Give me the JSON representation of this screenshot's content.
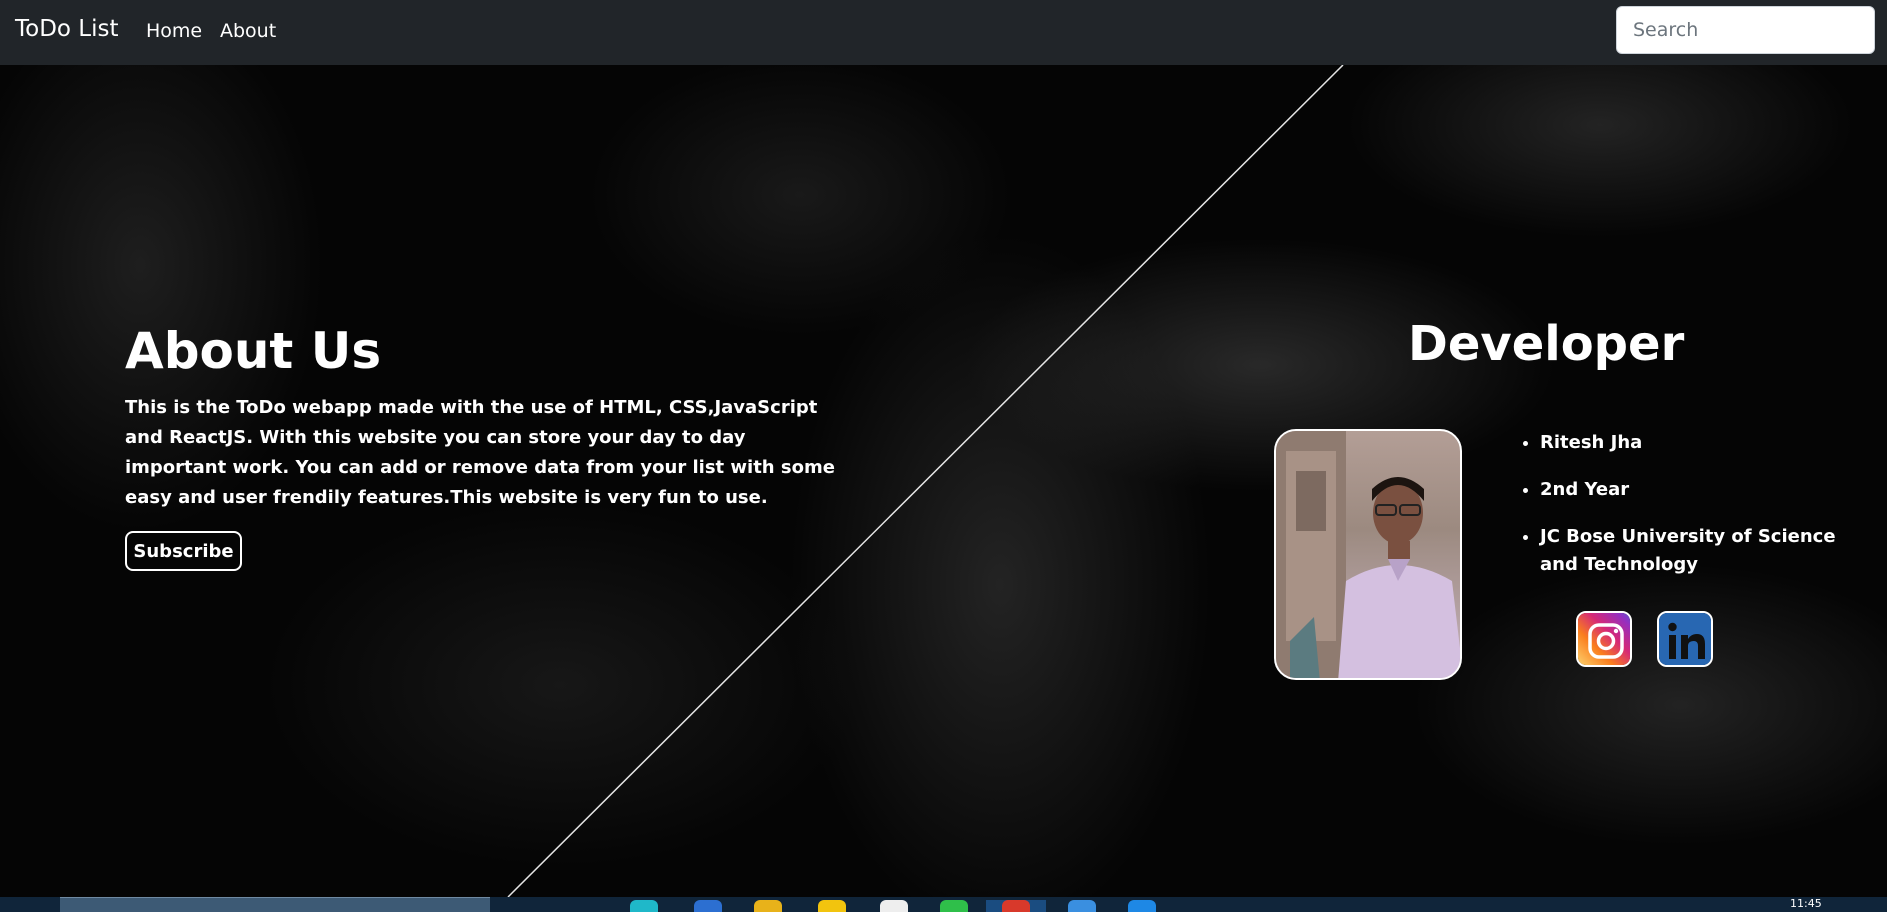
{
  "navbar": {
    "brand": "ToDo List",
    "links": [
      "Home",
      "About"
    ],
    "search_placeholder": "Search"
  },
  "about": {
    "title": "About Us",
    "text": "This is the ToDo webapp made with the use of HTML, CSS,JavaScript and ReactJS. With this website you can store your day to day important work. You can add or remove data from your list with some easy and user frendily features.This website is very fun to use.",
    "button": "Subscribe"
  },
  "developer": {
    "title": "Developer",
    "details": [
      "Ritesh Jha",
      "2nd Year",
      "JC Bose University of Science and Technology"
    ],
    "social": [
      "instagram-icon",
      "linkedin-icon"
    ]
  },
  "taskbar": {
    "clock": "11:45"
  },
  "colors": {
    "navbar_bg": "#212529",
    "page_bg": "#050505",
    "text": "#ffffff",
    "taskbar_bg": "#10253a"
  }
}
